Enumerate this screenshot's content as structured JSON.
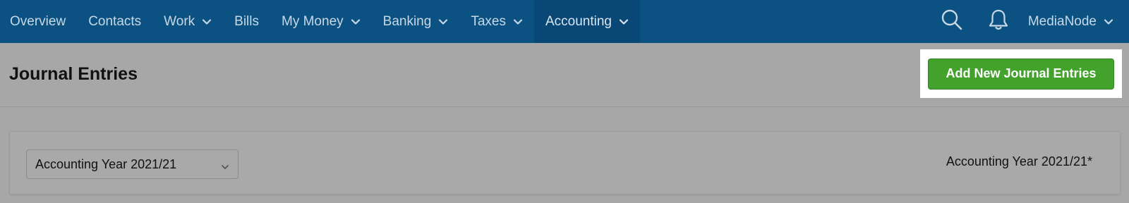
{
  "nav": {
    "items": [
      {
        "label": "Overview",
        "dropdown": false
      },
      {
        "label": "Contacts",
        "dropdown": false
      },
      {
        "label": "Work",
        "dropdown": true
      },
      {
        "label": "Bills",
        "dropdown": false
      },
      {
        "label": "My Money",
        "dropdown": true
      },
      {
        "label": "Banking",
        "dropdown": true
      },
      {
        "label": "Taxes",
        "dropdown": true
      },
      {
        "label": "Accounting",
        "dropdown": true,
        "active": true
      }
    ],
    "user": "MediaNode",
    "icons": [
      "search-icon",
      "bell-icon",
      "chevron-down-icon"
    ]
  },
  "page": {
    "title": "Journal Entries",
    "add_button": "Add New Journal Entries"
  },
  "filter": {
    "selected_year": "Accounting Year 2021/21",
    "current_year_label": "Accounting Year 2021/21*"
  },
  "colors": {
    "nav_bg": "#0b5182",
    "nav_active_bg": "#094777",
    "nav_text": "#c7d8e6",
    "page_bg": "#a7a7a7",
    "primary_button": "#42a22c"
  }
}
